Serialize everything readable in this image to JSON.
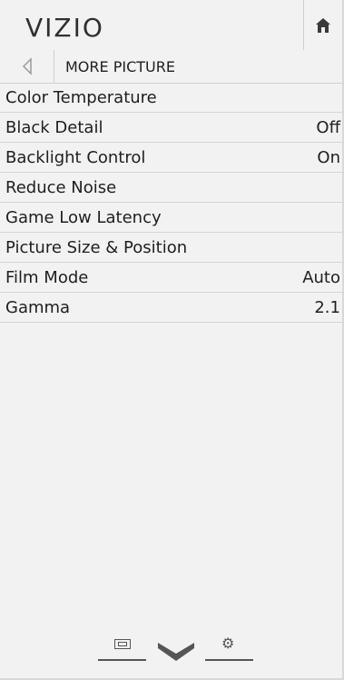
{
  "header": {
    "logo_text": "VIZIO",
    "home_icon": "home-icon"
  },
  "breadcrumb": {
    "back_icon": "back-arrow-icon",
    "title": "MORE PICTURE"
  },
  "menu": {
    "items": [
      {
        "label": "Color Temperature",
        "value": ""
      },
      {
        "label": "Black Detail",
        "value": "Off"
      },
      {
        "label": "Backlight Control",
        "value": "On"
      },
      {
        "label": "Reduce Noise",
        "value": ""
      },
      {
        "label": "Game Low Latency",
        "value": ""
      },
      {
        "label": "Picture Size & Position",
        "value": ""
      },
      {
        "label": "Film Mode",
        "value": "Auto"
      },
      {
        "label": "Gamma",
        "value": "2.1"
      }
    ]
  },
  "bottom_nav": {
    "items": [
      "input-icon",
      "vizio-v-icon",
      "settings-gear-icon"
    ]
  },
  "colors": {
    "background": "#f2f2f2",
    "divider": "#d4d4d4",
    "text": "#202020",
    "icon": "#555555"
  }
}
